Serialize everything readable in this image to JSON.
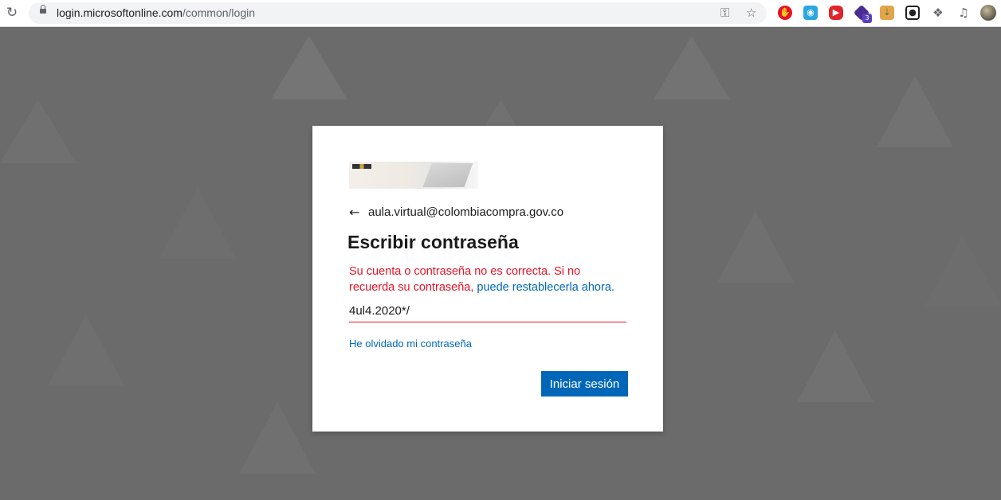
{
  "browser": {
    "url_host": "login.microsoftonline.com",
    "url_path": "/common/login",
    "extensions": [
      "adblock-icon",
      "screenshot-icon",
      "video-icon",
      "purple-extension-icon",
      "download-icon",
      "capture-icon",
      "puzzle-icon",
      "media-icon"
    ],
    "extension_badge": "3"
  },
  "signin": {
    "identity": "aula.virtual@colombiacompra.gov.co",
    "title": "Escribir contraseña",
    "error_text": "Su cuenta o contraseña no es correcta. Si no recuerda su contraseña, ",
    "error_link": "puede restablecerla ahora.",
    "password_value": "4ul4.2020*/",
    "forgot_link": "He olvidado mi contraseña",
    "submit_label": "Iniciar sesión"
  },
  "colors": {
    "accent": "#0067b8",
    "error": "#e81123",
    "background": "#6b6b6b"
  }
}
